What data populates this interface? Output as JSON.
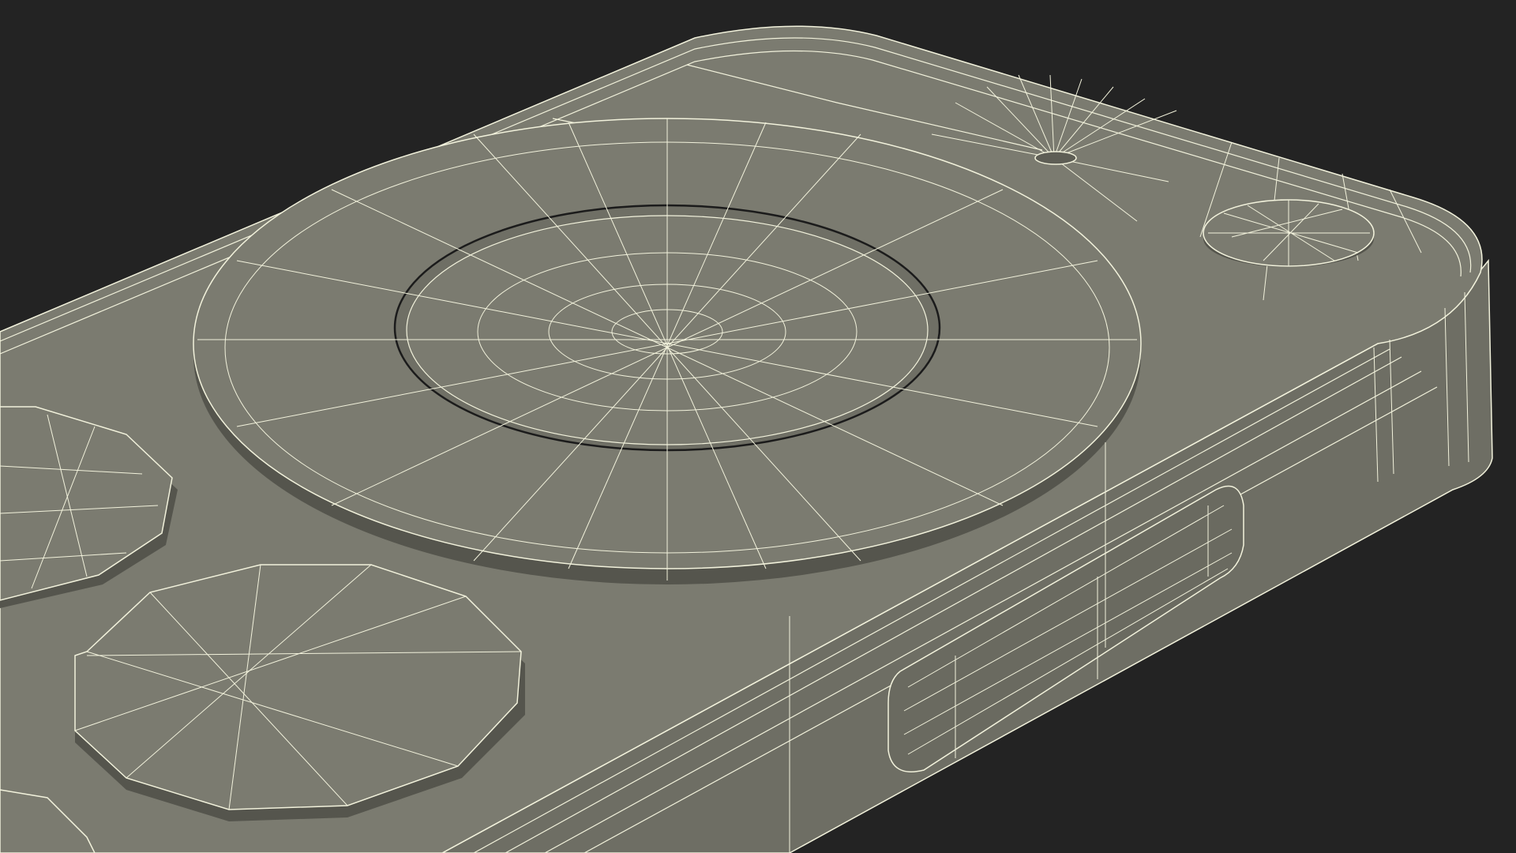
{
  "scene": {
    "subject": "phone-case-wireframe",
    "background_color": "#232323",
    "surface_color": "#7b7b70",
    "surface_dark_color": "#66665c",
    "wire_color": "#f2f2dc",
    "edge_shadow_color": "#4c4c45"
  }
}
